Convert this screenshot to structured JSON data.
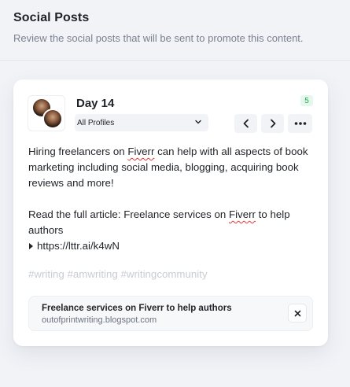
{
  "header": {
    "title": "Social Posts",
    "subtitle": "Review the social posts that will be sent to promote this content."
  },
  "post": {
    "day_title": "Day 14",
    "profile_select": "All Profiles",
    "count_badge": "5",
    "text": {
      "p1_a": "Hiring freelancers on ",
      "p1_fiverr": "Fiverr",
      "p1_b": " can help with all aspects of book marketing including social media, blogging, acquiring book reviews and more!",
      "p2_a": "Read the full article: Freelance services on ",
      "p2_fiverr": "Fiverr",
      "p2_b": " to help authors",
      "link": "https://lttr.ai/k4wN"
    },
    "hashtags": "#writing #amwriting #writingcommunity",
    "link_preview": {
      "title": "Freelance services on Fiverr to help authors",
      "domain": "outofprintwriting.blogspot.com"
    }
  },
  "colors": {
    "accent_green": "#22a45a",
    "badge_bg": "#e6f7ec",
    "hashtag_gray": "#c8ccd4"
  },
  "icons": {
    "prev": "chevron-left-icon",
    "next": "chevron-right-icon",
    "more": "more-horizontal-icon",
    "close": "close-icon",
    "dropdown": "chevron-down-icon",
    "link": "caret-right-icon"
  }
}
